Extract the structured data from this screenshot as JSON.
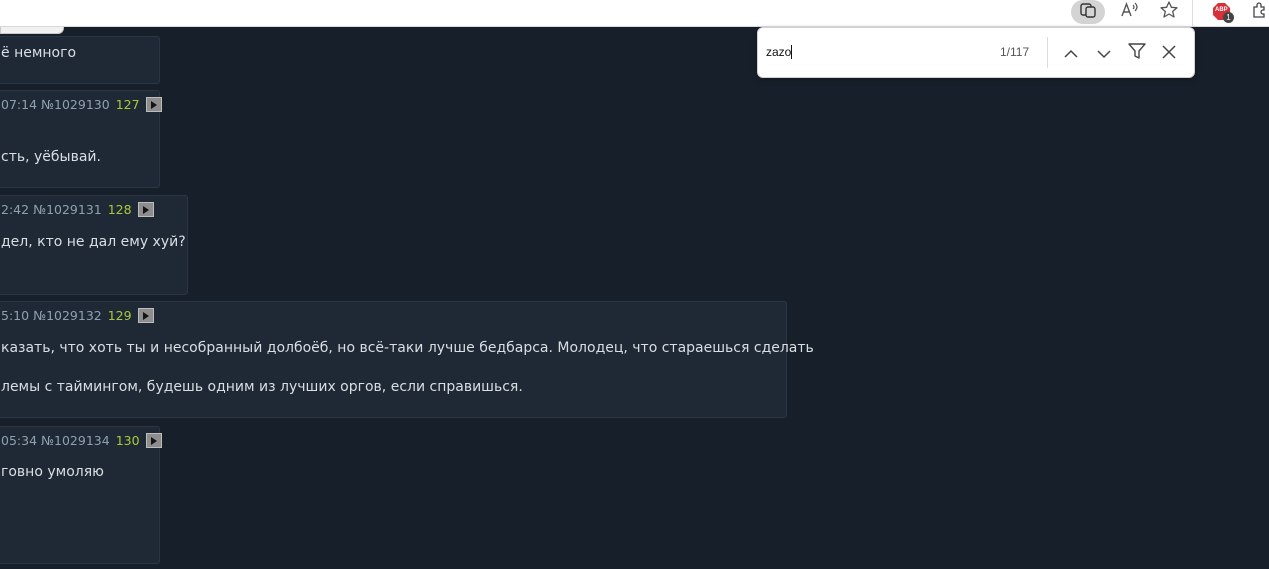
{
  "find": {
    "query": "zazo",
    "count": "1/117",
    "icons": [
      "previous-match-icon",
      "next-match-icon",
      "filter-icon",
      "close-icon"
    ]
  },
  "toolbar": {
    "icons": [
      "screen-share-icon",
      "read-aloud-icon",
      "favorite-star-icon",
      "adblock-extension-icon",
      "extensions-icon"
    ],
    "badge": "1",
    "adblock_label": "ABP"
  },
  "posts": [
    {
      "text1": "ё немного"
    },
    {
      "time": "07:14",
      "num": "№1029130",
      "count": "127",
      "text1": "сть, уёбывай."
    },
    {
      "time": "2:42",
      "num": "№1029131",
      "count": "128",
      "text1": "дел, кто не дал ему хуй?"
    },
    {
      "time": "5:10",
      "num": "№1029132",
      "count": "129",
      "text1": "казать, что хоть ты и несобранный долбоёб, но всё-таки лучше бедбарса. Молодец, что стараешься сделать",
      "text2": "лемы с таймингом, будешь одним из лучших оргов, если справишься."
    },
    {
      "time": "05:34",
      "num": "№1029134",
      "count": "130",
      "text1": "говно умоляю"
    }
  ],
  "colors": {
    "page_bg": "#17202a",
    "post_bg": "#1e2935",
    "count_green": "#a9c93c",
    "meta_gray": "#8fa0ae"
  }
}
